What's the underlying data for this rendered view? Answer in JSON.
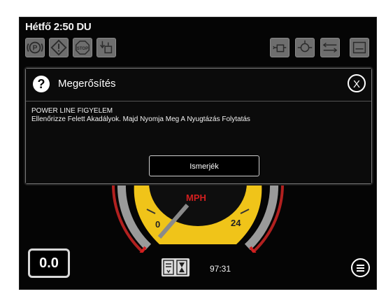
{
  "status_bar": {
    "datetime": "Hétfő 2:50 DU",
    "left_indicators": [
      "parking-brake-icon",
      "warning-triangle-icon",
      "stop-icon",
      "outrigger-icon"
    ],
    "right_indicators": [
      "engine-oil-icon",
      "engine-temp-icon",
      "boom-level-icon",
      "gauge-icon"
    ]
  },
  "dialog": {
    "title": "Megerősítés",
    "close_label": "X",
    "message_title": "POWER LINE FIGYELEM",
    "message_body": "Ellenőrizze Felett Akadályok. Majd Nyomja Meg A Nyugtázás Folytatás",
    "acknowledge_label": "Ismerjék"
  },
  "gauge": {
    "unit": "MPH",
    "tick_min": "0",
    "tick_max": "24",
    "needle_value": 0
  },
  "bottom_bar": {
    "speed_value": "0.0",
    "hour_meter": "97:31"
  },
  "colors": {
    "accent_yellow": "#f0c419",
    "danger_red": "#d21f1f"
  }
}
